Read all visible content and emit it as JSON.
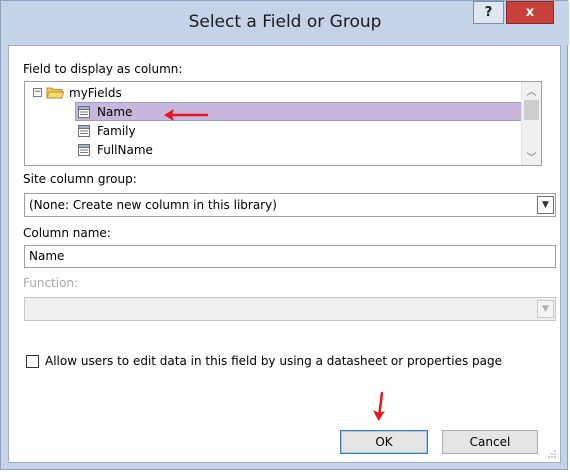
{
  "window": {
    "title": "Select a Field or Group",
    "help_label": "?",
    "close_label": "x"
  },
  "field_section": {
    "label": "Field to display as column:",
    "tree": {
      "root": {
        "label": "myFields",
        "expander": "−",
        "icon": "folder-icon"
      },
      "children": [
        {
          "label": "Name",
          "icon": "field-icon",
          "selected": true
        },
        {
          "label": "Family",
          "icon": "field-icon",
          "selected": false
        },
        {
          "label": "FullName",
          "icon": "field-icon",
          "selected": false
        }
      ]
    }
  },
  "site_column_group": {
    "label": "Site column group:",
    "value": "(None: Create new column in this library)"
  },
  "column_name": {
    "label": "Column name:",
    "value": "Name"
  },
  "function": {
    "label": "Function:",
    "value": "",
    "disabled": true
  },
  "checkbox": {
    "label": "Allow users to edit data in this field by using a datasheet or properties page",
    "checked": false
  },
  "buttons": {
    "ok": "OK",
    "cancel": "Cancel"
  },
  "colors": {
    "titlebar": "#c4d3e8",
    "close_button": "#c7403a",
    "selection": "#c9b6dd",
    "annotation_arrow": "#e8141e"
  }
}
